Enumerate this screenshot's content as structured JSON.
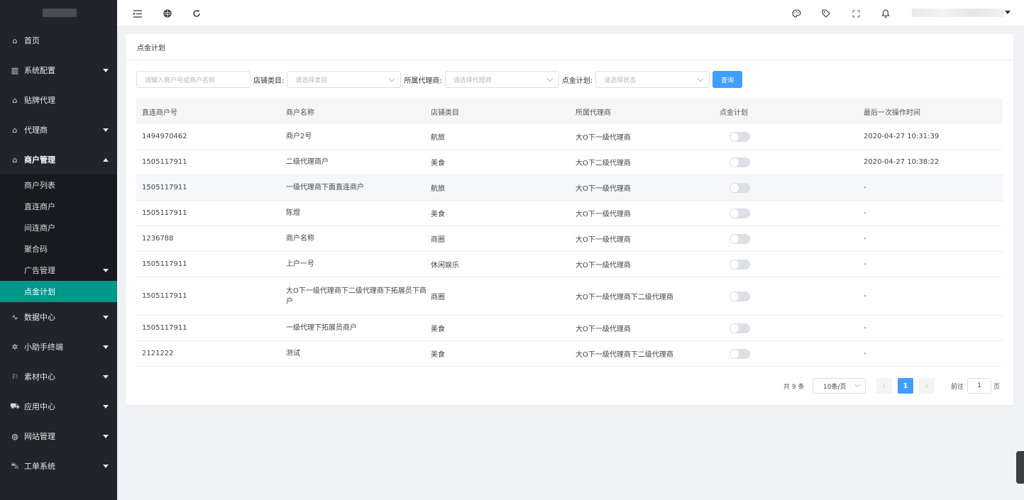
{
  "sidebar": {
    "items": [
      {
        "label": "首页",
        "icon": "home-icon"
      },
      {
        "label": "系统配置",
        "icon": "layout-icon"
      },
      {
        "label": "贴牌代理",
        "icon": "home-icon"
      },
      {
        "label": "代理商",
        "icon": "home-icon"
      },
      {
        "label": "商户管理",
        "icon": "home-icon"
      },
      {
        "label": "数据中心",
        "icon": "pulse-icon"
      },
      {
        "label": "小助手终端",
        "icon": "cross-icon"
      },
      {
        "label": "素材中心",
        "icon": "flag-icon"
      },
      {
        "label": "应用中心",
        "icon": "cart-icon"
      },
      {
        "label": "网站管理",
        "icon": "globe-icon"
      },
      {
        "label": "工单系统",
        "icon": "bus-icon"
      }
    ],
    "submenu": [
      "商户列表",
      "直连商户",
      "间连商户",
      "聚合码",
      "广告管理",
      "点金计划"
    ]
  },
  "topbar": {
    "icons": [
      "menu-fold-icon",
      "globe-icon",
      "refresh-icon",
      "palette-icon",
      "tag-icon",
      "fullscreen-icon",
      "bell-icon"
    ]
  },
  "card": {
    "title": "点金计划"
  },
  "filters": {
    "merchant_placeholder": "请输入商户号或商户名称",
    "category_label": "店铺类目:",
    "category_placeholder": "请选择类目",
    "agent_label": "所属代理商:",
    "agent_placeholder": "请选择代理商",
    "plan_label": "点金计划:",
    "plan_placeholder": "请选择状态",
    "query_button": "查询"
  },
  "table": {
    "headers": [
      "直连商户号",
      "商户名称",
      "店铺类目",
      "所属代理商",
      "点金计划",
      "最后一次操作时间"
    ],
    "rows": [
      {
        "id": "1494970462",
        "name": "商户2号",
        "category": "航旅",
        "agent": "大O下一级代理商",
        "enabled": false,
        "time": "2020-04-27 10:31:39"
      },
      {
        "id": "1505117911",
        "name": "二级代理商户",
        "category": "美食",
        "agent": "大O下二级代理商",
        "enabled": false,
        "time": "2020-04-27 10:38:22"
      },
      {
        "id": "1505117911",
        "name": "一级代理商下面直连商户",
        "category": "航旅",
        "agent": "大O下一级代理商",
        "enabled": false,
        "time": "-"
      },
      {
        "id": "1505117911",
        "name": "陈煜",
        "category": "美食",
        "agent": "大O下一级代理商",
        "enabled": false,
        "time": "-"
      },
      {
        "id": "1236788",
        "name": "商户名称",
        "category": "商圈",
        "agent": "大O下一级代理商",
        "enabled": false,
        "time": "-"
      },
      {
        "id": "1505117911",
        "name": "上户一号",
        "category": "休闲娱乐",
        "agent": "大O下一级代理商",
        "enabled": false,
        "time": "-"
      },
      {
        "id": "1505117911",
        "name": "大O下一级代理商下二级代理商下拓展员下商户",
        "category": "商圈",
        "agent": "大O下一级代理商下二级代理商",
        "enabled": false,
        "time": "-"
      },
      {
        "id": "1505117911",
        "name": "一级代理下拓展员商户",
        "category": "美食",
        "agent": "大O下一级代理商",
        "enabled": false,
        "time": "-"
      },
      {
        "id": "2121222",
        "name": "测试",
        "category": "美食",
        "agent": "大O下一级代理商下二级代理商",
        "enabled": false,
        "time": "-"
      }
    ]
  },
  "pagination": {
    "total": "共 9 条",
    "page_size": "10条/页",
    "current_page": "1",
    "goto_label": "前往",
    "goto_value": "1",
    "goto_unit": "页"
  },
  "colors": {
    "sidebar_bg": "#21252b",
    "active_item": "#009688",
    "primary": "#409eff"
  }
}
